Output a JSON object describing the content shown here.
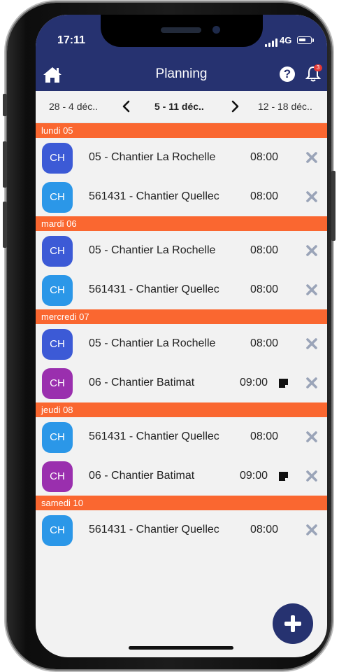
{
  "status_bar": {
    "time": "17:11",
    "network": "4G",
    "notification_count": "3"
  },
  "header": {
    "title": "Planning"
  },
  "week_nav": {
    "prev": "28 - 4 déc..",
    "current": "5 - 11 déc..",
    "next": "12 - 18 déc.."
  },
  "colors": {
    "header": "#263270",
    "day_header": "#fa6730",
    "blue_dark": "#3c5ad6",
    "blue_light": "#2b97e8",
    "purple": "#9a2fae",
    "delete": "#9aa4b8"
  },
  "days": [
    {
      "label": "lundi 05",
      "items": [
        {
          "initials": "CH",
          "color": "#3c5ad6",
          "name": "05 - Chantier La Rochelle",
          "time": "08:00",
          "note": false
        },
        {
          "initials": "CH",
          "color": "#2b97e8",
          "name": "561431 - Chantier Quellec",
          "time": "08:00",
          "note": false
        }
      ]
    },
    {
      "label": "mardi 06",
      "items": [
        {
          "initials": "CH",
          "color": "#3c5ad6",
          "name": "05 - Chantier La Rochelle",
          "time": "08:00",
          "note": false
        },
        {
          "initials": "CH",
          "color": "#2b97e8",
          "name": "561431 - Chantier Quellec",
          "time": "08:00",
          "note": false
        }
      ]
    },
    {
      "label": "mercredi 07",
      "items": [
        {
          "initials": "CH",
          "color": "#3c5ad6",
          "name": "05 - Chantier La Rochelle",
          "time": "08:00",
          "note": false
        },
        {
          "initials": "CH",
          "color": "#9a2fae",
          "name": "06 - Chantier Batimat",
          "time": "09:00",
          "note": true
        }
      ]
    },
    {
      "label": "jeudi 08",
      "items": [
        {
          "initials": "CH",
          "color": "#2b97e8",
          "name": "561431 - Chantier Quellec",
          "time": "08:00",
          "note": false
        },
        {
          "initials": "CH",
          "color": "#9a2fae",
          "name": "06 - Chantier Batimat",
          "time": "09:00",
          "note": true
        }
      ]
    },
    {
      "label": "samedi 10",
      "items": [
        {
          "initials": "CH",
          "color": "#2b97e8",
          "name": "561431 - Chantier Quellec",
          "time": "08:00",
          "note": false
        }
      ]
    }
  ]
}
